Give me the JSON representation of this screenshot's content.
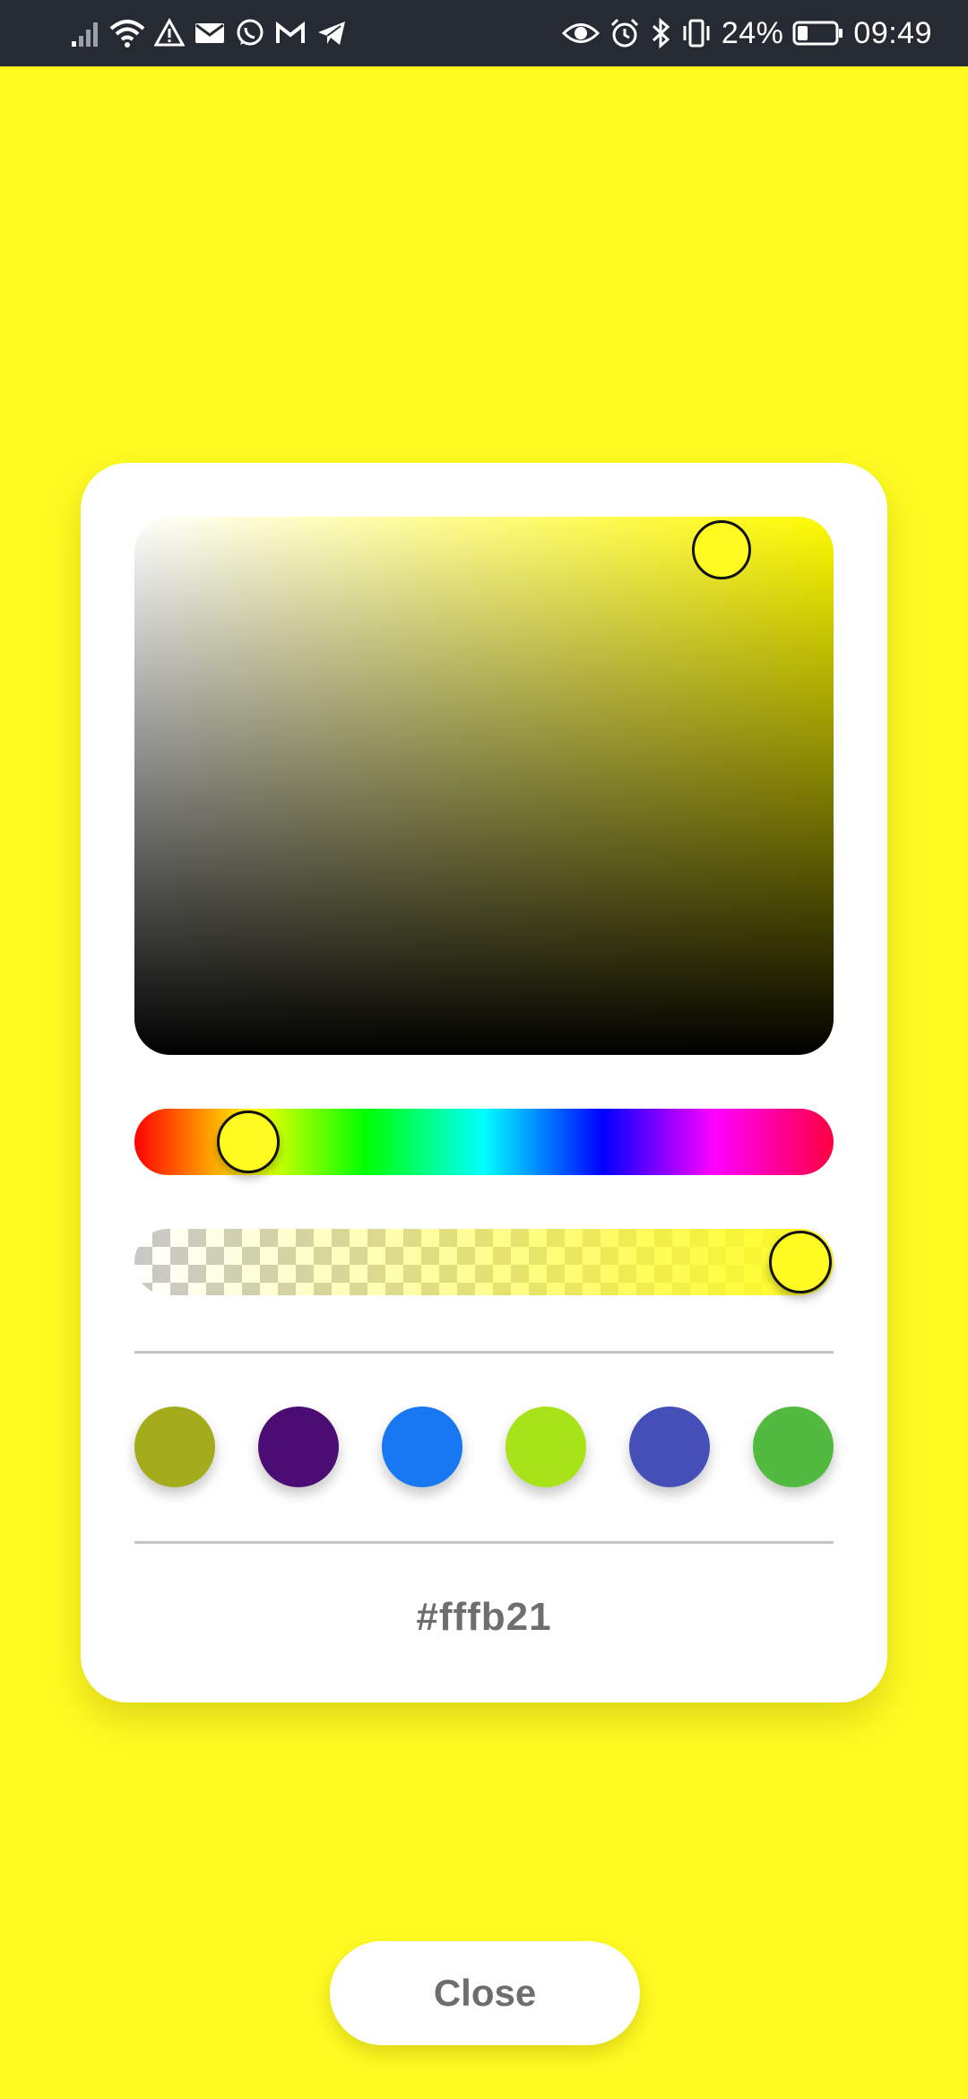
{
  "status_bar": {
    "battery": "24%",
    "time": "09:49",
    "left_icons": [
      "signal-icon",
      "wifi-icon",
      "warning-icon",
      "mail-icon",
      "whatsapp-icon",
      "gmail-icon",
      "telegram-icon"
    ],
    "right_icons": [
      "eye-icon",
      "alarm-icon",
      "bluetooth-icon",
      "vibrate-icon",
      "battery-icon"
    ]
  },
  "picker": {
    "hex": "#fffb21",
    "hue_color": "#fffb00",
    "hue_position": 0.163,
    "alpha_position": 0.95,
    "saturation": 0.84,
    "value": 1.0,
    "swatches": [
      "#a4ac1b",
      "#4b0d73",
      "#1877f2",
      "#a8e31a",
      "#4450b8",
      "#52bb3f"
    ]
  },
  "colors": {
    "background": "#fffb21",
    "status_bar": "#262b33",
    "card": "#ffffff",
    "text_muted": "#6e6e6e"
  },
  "close_button": {
    "label": "Close"
  }
}
